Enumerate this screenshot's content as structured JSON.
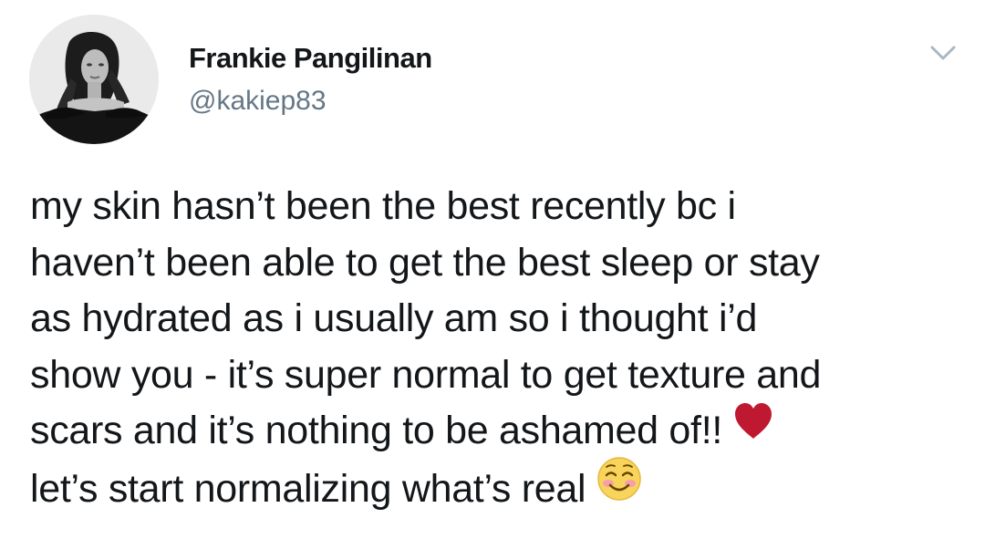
{
  "tweet": {
    "author_name": "Frankie Pangilinan",
    "author_handle": "@kakiep83",
    "text_lines": [
      "my skin hasn’t been the best recently bc i",
      "haven’t been able to get the best sleep or stay",
      "as hydrated as i usually am so i thought i’d",
      "show you - it’s super normal to get texture and",
      "scars and it’s nothing to be ashamed of!!",
      "let’s start normalizing what’s real"
    ],
    "emojis": [
      "red-heart-icon",
      "smiling-face-with-blush-icon"
    ],
    "menu_icon": "chevron-down-icon"
  },
  "colors": {
    "name": "#14171a",
    "handle": "#657786",
    "text": "#14171a",
    "chevron": "#aab8c2",
    "heart": "#be1931",
    "background": "#ffffff"
  }
}
